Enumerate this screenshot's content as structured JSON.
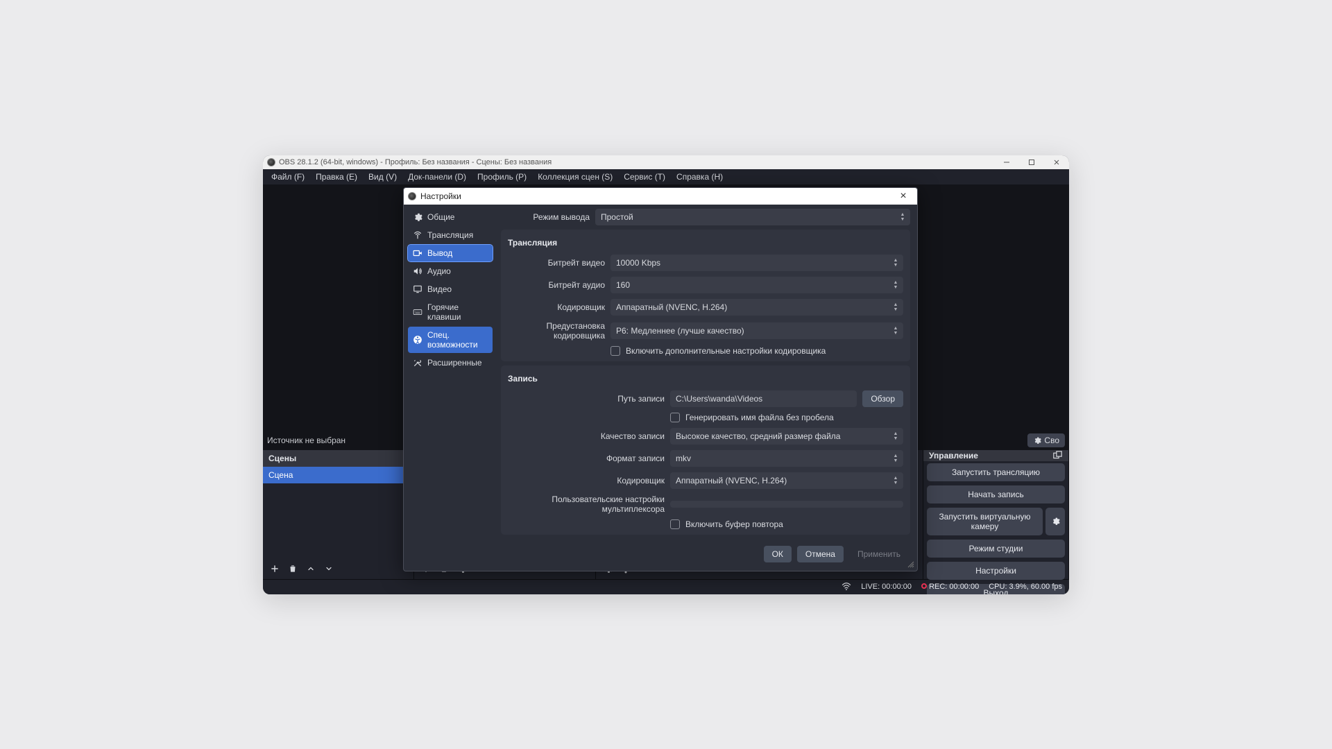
{
  "window": {
    "title": "OBS 28.1.2 (64-bit, windows) - Профиль: Без названия - Сцены: Без названия"
  },
  "menu": {
    "file": "Файл (F)",
    "edit": "Правка (E)",
    "view": "Вид (V)",
    "docks": "Док-панели (D)",
    "profile": "Профиль (P)",
    "scenes": "Коллекция сцен (S)",
    "tools": "Сервис (T)",
    "help": "Справка (H)"
  },
  "source_toolbar": {
    "no_source": "Источник не выбран",
    "properties": "Сво"
  },
  "docks": {
    "scenes_title": "Сцены",
    "scene_item": "Сцена",
    "controls_title": "Управление"
  },
  "controls": {
    "start_stream": "Запустить трансляцию",
    "start_record": "Начать запись",
    "start_vcam": "Запустить виртуальную камеру",
    "studio_mode": "Режим студии",
    "settings": "Настройки",
    "exit": "Выход"
  },
  "status": {
    "live": "LIVE: 00:00:00",
    "rec": "REC: 00:00:00",
    "cpu": "CPU: 3.9%, 60.00 fps"
  },
  "settings_dialog": {
    "title": "Настройки",
    "nav": {
      "general": "Общие",
      "stream": "Трансляция",
      "output": "Вывод",
      "audio": "Аудио",
      "video": "Видео",
      "hotkeys": "Горячие клавиши",
      "accessibility": "Спец. возможности",
      "advanced": "Расширенные"
    },
    "output_mode_label": "Режим вывода",
    "output_mode_value": "Простой",
    "streaming": {
      "title": "Трансляция",
      "video_bitrate_label": "Битрейт видео",
      "video_bitrate_value": "10000 Kbps",
      "audio_bitrate_label": "Битрейт аудио",
      "audio_bitrate_value": "160",
      "encoder_label": "Кодировщик",
      "encoder_value": "Аппаратный (NVENC, H.264)",
      "preset_label": "Предустановка кодировщика",
      "preset_value": "P6: Медленнее (лучше качество)",
      "advanced_enc_label": "Включить дополнительные настройки кодировщика"
    },
    "recording": {
      "title": "Запись",
      "path_label": "Путь записи",
      "path_value": "C:\\Users\\wanda\\Videos",
      "browse": "Обзор",
      "no_space_label": "Генерировать имя файла без пробела",
      "quality_label": "Качество записи",
      "quality_value": "Высокое качество, средний размер файла",
      "format_label": "Формат записи",
      "format_value": "mkv",
      "encoder_label": "Кодировщик",
      "encoder_value": "Аппаратный (NVENC, H.264)",
      "muxer_label": "Пользовательские настройки мультиплексора",
      "replay_buffer_label": "Включить буфер повтора"
    },
    "buttons": {
      "ok": "ОК",
      "cancel": "Отмена",
      "apply": "Применить"
    }
  }
}
